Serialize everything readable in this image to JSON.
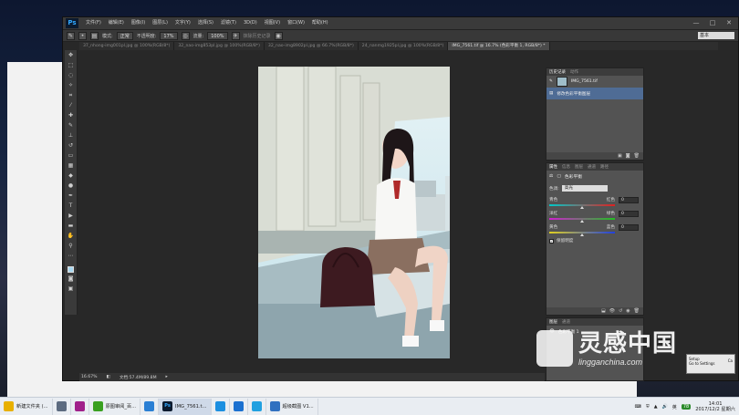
{
  "app": {
    "logo": "Ps",
    "menu": [
      "文件(F)",
      "编辑(E)",
      "图像(I)",
      "图层(L)",
      "文字(Y)",
      "选择(S)",
      "滤镜(T)",
      "3D(D)",
      "视图(V)",
      "窗口(W)",
      "帮助(H)"
    ],
    "window_controls": [
      "—",
      "□",
      "✕"
    ]
  },
  "options_bar": {
    "mode_label": "模式:",
    "mode_value": "正常",
    "opacity_label": "不透明度:",
    "opacity_value": "17%",
    "flow_label": "流量:",
    "flow_value": "100%",
    "history_label": "抹除历史记录",
    "workspace": "基本"
  },
  "tabs": [
    {
      "label": "37_nhong-img001pl.jpg @ 100%(RGB/8*)",
      "active": false
    },
    {
      "label": "32_nao-img853pl.jpg @ 100%(RGB/8*)",
      "active": false
    },
    {
      "label": "32_nao-img8902pl.jpg @ 66.7%(RGB/8*)",
      "active": false
    },
    {
      "label": "24_nanmg1925pl.jpg @ 100%(RGB/8*)",
      "active": false
    },
    {
      "label": "IMG_7561.tif @ 16.7% (色彩平衡 1, RGB/8*) *",
      "active": true
    }
  ],
  "history_panel": {
    "tabs": [
      "历史记录",
      "动作"
    ],
    "snapshot": "IMG_7561.tif",
    "step": "修改色彩平衡图层"
  },
  "properties_panel": {
    "tabs": [
      "属性",
      "信息",
      "图层",
      "通道",
      "路径"
    ],
    "title": "色彩平衡",
    "tone_label": "色调:",
    "tone_value": "高光",
    "sliders": [
      {
        "left": "青色",
        "right": "红色",
        "value": "0",
        "position": 0.5,
        "gradient": [
          "#00c8c8",
          "#e02020"
        ]
      },
      {
        "left": "洋红",
        "right": "绿色",
        "value": "0",
        "position": 0.5,
        "gradient": [
          "#d020d0",
          "#20c020"
        ]
      },
      {
        "left": "黄色",
        "right": "蓝色",
        "value": "0",
        "position": 0.5,
        "gradient": [
          "#e0d020",
          "#2040e0"
        ]
      }
    ],
    "preserve_luminosity": "保留明度"
  },
  "layers_panel": {
    "tabs": [
      "图层",
      "通道"
    ],
    "item": "色彩平衡 1"
  },
  "status_bar": {
    "zoom": "16.67%",
    "doc": "文档:57.4M/89.8M"
  },
  "watermark": {
    "cn": "灵感中国",
    "en": "lingganchina.com"
  },
  "dialog": {
    "line1": "Setup",
    "line2": "Go to Settings",
    "btn": "Ca"
  },
  "taskbar": {
    "items": [
      {
        "label": "新建文件夹 (...",
        "icon": "folder-icon",
        "color": "#e8b000",
        "active": false
      },
      {
        "label": "",
        "icon": "computer-icon",
        "color": "#5c6b80",
        "active": false
      },
      {
        "label": "",
        "icon": "app-icon",
        "color": "#a0208a",
        "active": false
      },
      {
        "label": "原图审阅_百...",
        "icon": "browser-icon",
        "color": "#3aa020",
        "active": false
      },
      {
        "label": "",
        "icon": "paper-plane-icon",
        "color": "#2a7fd4",
        "active": false
      },
      {
        "label": "IMG_7561.t...",
        "icon": "photoshop-icon",
        "color": "#0b1a2e",
        "active": true
      },
      {
        "label": "",
        "icon": "chat-icon",
        "color": "#1c8fe0",
        "active": false
      },
      {
        "label": "",
        "icon": "globe-icon",
        "color": "#1a70d0",
        "active": false
      },
      {
        "label": "",
        "icon": "cloud-icon",
        "color": "#20a0e0",
        "active": false
      },
      {
        "label": "超级截图 V1...",
        "icon": "screenshot-icon",
        "color": "#3070c0",
        "active": false
      }
    ],
    "tray_lang": "英",
    "tray_badge": "78",
    "time": "14:01",
    "date": "2017/12/2 星期六"
  }
}
